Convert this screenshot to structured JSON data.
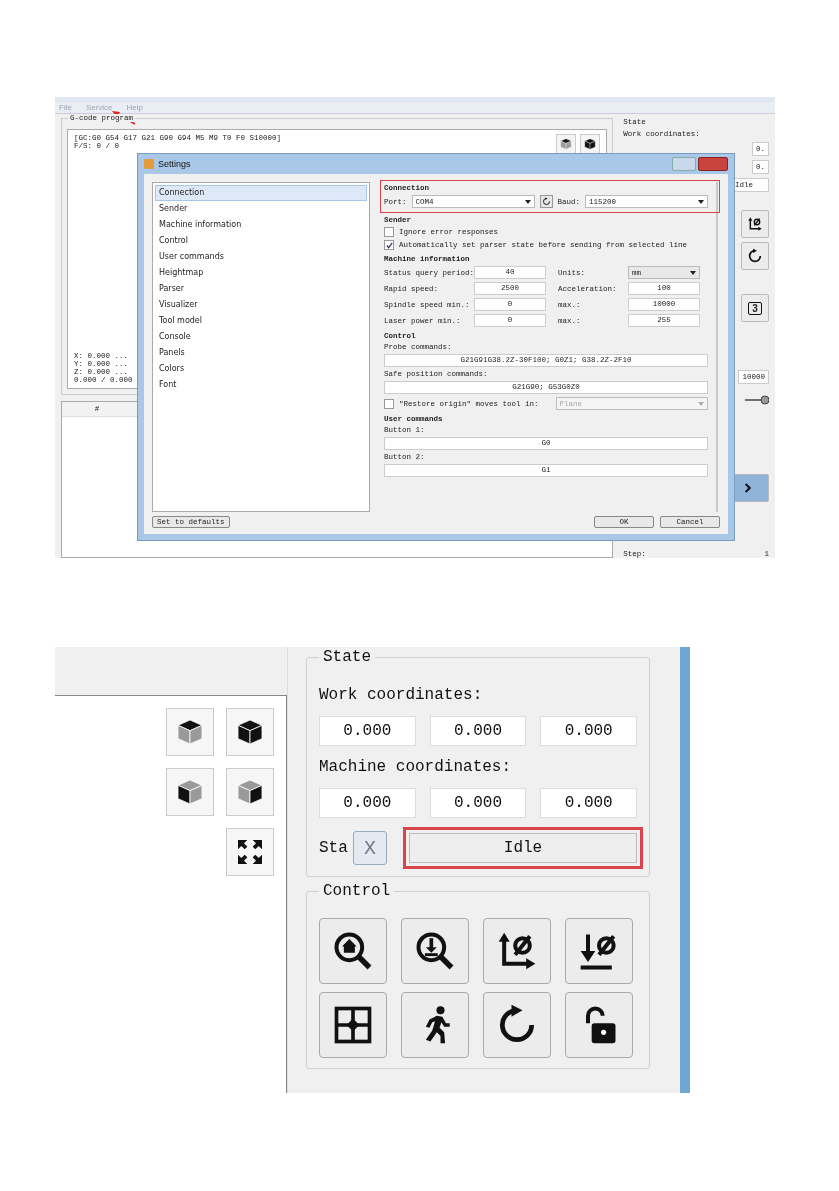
{
  "screenshot_1": {
    "menu": [
      {
        "label": "File"
      },
      {
        "label": "Service"
      },
      {
        "label": "Help"
      }
    ],
    "gcode_program": {
      "title": "G-code program",
      "status_lines": [
        "[GC:G0 G54 G17 G21 G90 G94 M5 M9 T0 F0 S10000]",
        "F/S: 0 / 0"
      ],
      "coordinate_lines": [
        "X: 0.000 ...",
        "Y: 0.000 ...",
        "Z: 0.000 ...",
        "0.000 / 0.000"
      ]
    },
    "table": {
      "columns": [
        "#"
      ]
    },
    "state_panel": {
      "title": "State",
      "work_coordinates_label": "Work coordinates:",
      "work_value": "0.",
      "machine_value": "0.",
      "status": "Idle",
      "key_label": "3",
      "feed_value": "10000",
      "step_label": "Step:",
      "step_value": "1"
    },
    "settings": {
      "title": "Settings",
      "sections": [
        {
          "label": "Connection",
          "selected": true
        },
        {
          "label": "Sender",
          "selected": false
        },
        {
          "label": "Machine information",
          "selected": false
        },
        {
          "label": "Control",
          "selected": false
        },
        {
          "label": "User commands",
          "selected": false
        },
        {
          "label": "Heightmap",
          "selected": false
        },
        {
          "label": "Parser",
          "selected": false
        },
        {
          "label": "Visualizer",
          "selected": false
        },
        {
          "label": "Tool model",
          "selected": false
        },
        {
          "label": "Console",
          "selected": false
        },
        {
          "label": "Panels",
          "selected": false
        },
        {
          "label": "Colors",
          "selected": false
        },
        {
          "label": "Font",
          "selected": false
        }
      ],
      "connection": {
        "title": "Connection",
        "port_label": "Port:",
        "port": "COM4",
        "baud_label": "Baud:",
        "baud": "115200"
      },
      "sender": {
        "title": "Sender",
        "options": [
          {
            "label": "Ignore error responses",
            "checked": false
          },
          {
            "label": "Automatically set parser state before sending from selected line",
            "checked": true
          }
        ]
      },
      "machine_information": {
        "title": "Machine information",
        "fields": [
          {
            "label": "Status query period:",
            "value": "40",
            "kind": "input"
          },
          {
            "label": "Units:",
            "value": "mm",
            "kind": "select"
          },
          {
            "label": "Rapid speed:",
            "value": "2500",
            "kind": "input"
          },
          {
            "label": "Acceleration:",
            "value": "100",
            "kind": "input"
          },
          {
            "label": "Spindle speed min.:",
            "value": "0",
            "kind": "input"
          },
          {
            "label": "max.:",
            "value": "10000",
            "kind": "input"
          },
          {
            "label": "Laser power min.:",
            "value": "0",
            "kind": "input"
          },
          {
            "label": "max.:",
            "value": "255",
            "kind": "input"
          }
        ]
      },
      "control": {
        "title": "Control",
        "probe_label": "Probe commands:",
        "probe": "G21G91G38.2Z-30F100; G0Z1; G38.2Z-2F10",
        "safe_label": "Safe position commands:",
        "safe": "G21G90; G53G0Z0",
        "restore_origin": {
          "label": "\"Restore origin\" moves tool in:",
          "checked": false,
          "mode": "Plane",
          "disabled": true
        }
      },
      "user_commands": {
        "title": "User commands",
        "buttons": [
          {
            "label": "Button 1:",
            "value": "G0"
          },
          {
            "label": "Button 2:",
            "value": "G1"
          }
        ]
      },
      "defaults_button": "Set to defaults",
      "ok_button": "OK",
      "cancel_button": "Cancel"
    }
  },
  "screenshot_2": {
    "state": {
      "title": "State",
      "work_label": "Work coordinates:",
      "work": [
        "0.000",
        "0.000",
        "0.000"
      ],
      "machine_label": "Machine coordinates:",
      "machine": [
        "0.000",
        "0.000",
        "0.000"
      ],
      "status_label": "Sta",
      "close_glyph": "X",
      "status": "Idle"
    },
    "control": {
      "title": "Control"
    }
  }
}
